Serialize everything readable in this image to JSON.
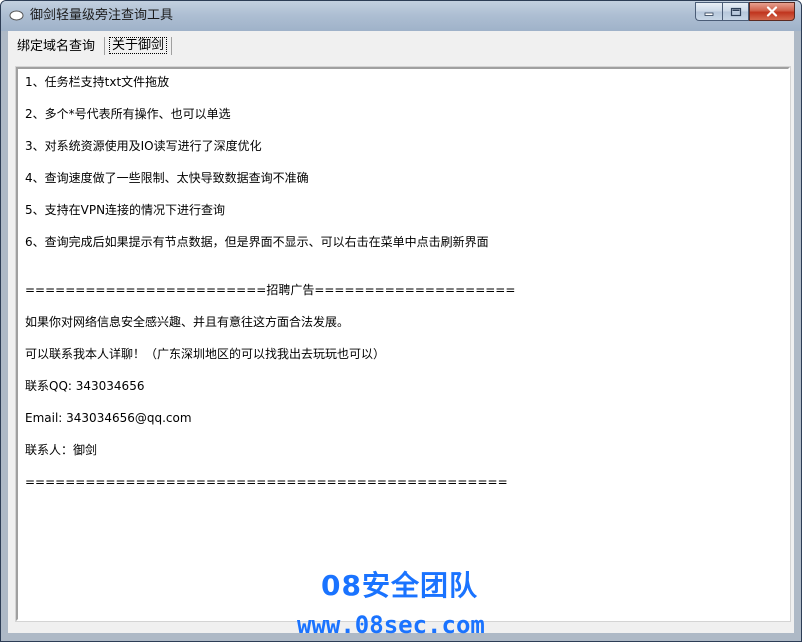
{
  "window": {
    "title": "御剑轻量级旁注查询工具"
  },
  "tabs": [
    {
      "label": "绑定域名查询",
      "selected": false
    },
    {
      "label": "关于御剑",
      "selected": true
    }
  ],
  "about_lines": [
    "1、任务栏支持txt文件拖放",
    "2、多个*号代表所有操作、也可以单选",
    "3、对系统资源使用及IO读写进行了深度优化",
    "4、查询速度做了一些限制、太快导致数据查询不准确",
    "5、支持在VPN连接的情况下进行查询",
    "6、查询完成后如果提示有节点数据，但是界面不显示、可以右击在菜单中点击刷新界面",
    "========================招聘广告====================",
    "如果你对网络信息安全感兴趣、并且有意往这方面合法发展。",
    "可以联系我本人详聊！（广东深圳地区的可以找我出去玩玩也可以）",
    "联系QQ: 343034656",
    "Email: 343034656@qq.com",
    "联系人：御剑",
    "================================================"
  ],
  "watermark": {
    "line1": "08安全团队",
    "line2": "www.08sec.com",
    "color": "#1a73ff"
  },
  "colors": {
    "titlebar": "#aebfd3",
    "close_button": "#c0341e",
    "panel_bg": "#ffffff"
  },
  "icons": {
    "app": "app-icon",
    "minimize": "minimize-icon",
    "maximize": "maximize-icon",
    "close": "close-icon"
  }
}
